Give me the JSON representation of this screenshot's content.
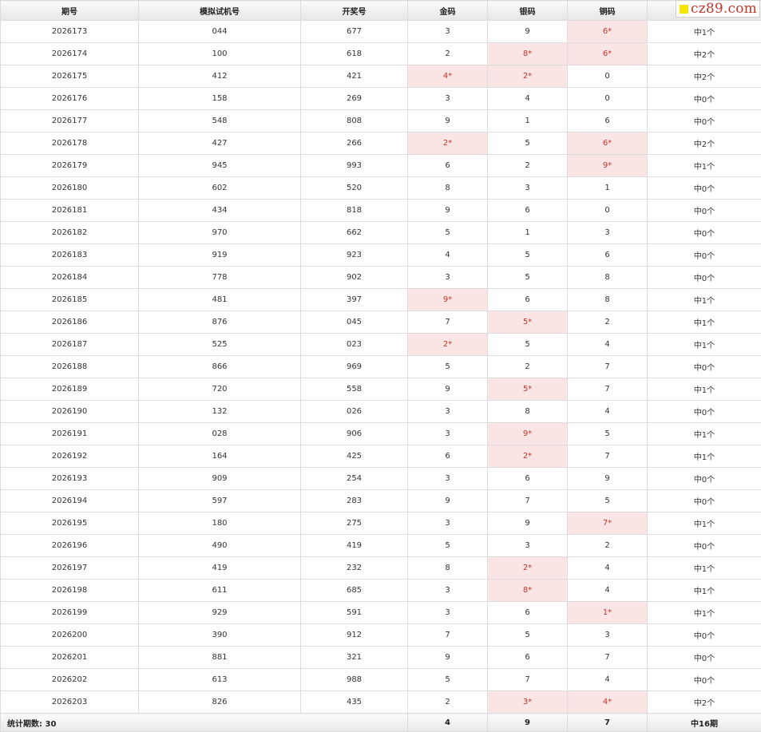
{
  "table": {
    "columns": [
      "期号",
      "模拟试机号",
      "开奖号",
      "金码",
      "银码",
      "铜码",
      ""
    ],
    "rows": [
      {
        "period": "2026173",
        "trial": "044",
        "draw": "677",
        "gold": "3",
        "silver": "9",
        "copper": "6*",
        "result": "中1个"
      },
      {
        "period": "2026174",
        "trial": "100",
        "draw": "618",
        "gold": "2",
        "silver": "8*",
        "copper": "6*",
        "result": "中2个"
      },
      {
        "period": "2026175",
        "trial": "412",
        "draw": "421",
        "gold": "4*",
        "silver": "2*",
        "copper": "0",
        "result": "中2个"
      },
      {
        "period": "2026176",
        "trial": "158",
        "draw": "269",
        "gold": "3",
        "silver": "4",
        "copper": "0",
        "result": "中0个"
      },
      {
        "period": "2026177",
        "trial": "548",
        "draw": "808",
        "gold": "9",
        "silver": "1",
        "copper": "6",
        "result": "中0个"
      },
      {
        "period": "2026178",
        "trial": "427",
        "draw": "266",
        "gold": "2*",
        "silver": "5",
        "copper": "6*",
        "result": "中2个"
      },
      {
        "period": "2026179",
        "trial": "945",
        "draw": "993",
        "gold": "6",
        "silver": "2",
        "copper": "9*",
        "result": "中1个"
      },
      {
        "period": "2026180",
        "trial": "602",
        "draw": "520",
        "gold": "8",
        "silver": "3",
        "copper": "1",
        "result": "中0个"
      },
      {
        "period": "2026181",
        "trial": "434",
        "draw": "818",
        "gold": "9",
        "silver": "6",
        "copper": "0",
        "result": "中0个"
      },
      {
        "period": "2026182",
        "trial": "970",
        "draw": "662",
        "gold": "5",
        "silver": "1",
        "copper": "3",
        "result": "中0个"
      },
      {
        "period": "2026183",
        "trial": "919",
        "draw": "923",
        "gold": "4",
        "silver": "5",
        "copper": "6",
        "result": "中0个"
      },
      {
        "period": "2026184",
        "trial": "778",
        "draw": "902",
        "gold": "3",
        "silver": "5",
        "copper": "8",
        "result": "中0个"
      },
      {
        "period": "2026185",
        "trial": "481",
        "draw": "397",
        "gold": "9*",
        "silver": "6",
        "copper": "8",
        "result": "中1个"
      },
      {
        "period": "2026186",
        "trial": "876",
        "draw": "045",
        "gold": "7",
        "silver": "5*",
        "copper": "2",
        "result": "中1个"
      },
      {
        "period": "2026187",
        "trial": "525",
        "draw": "023",
        "gold": "2*",
        "silver": "5",
        "copper": "4",
        "result": "中1个"
      },
      {
        "period": "2026188",
        "trial": "866",
        "draw": "969",
        "gold": "5",
        "silver": "2",
        "copper": "7",
        "result": "中0个"
      },
      {
        "period": "2026189",
        "trial": "720",
        "draw": "558",
        "gold": "9",
        "silver": "5*",
        "copper": "7",
        "result": "中1个"
      },
      {
        "period": "2026190",
        "trial": "132",
        "draw": "026",
        "gold": "3",
        "silver": "8",
        "copper": "4",
        "result": "中0个"
      },
      {
        "period": "2026191",
        "trial": "028",
        "draw": "906",
        "gold": "3",
        "silver": "9*",
        "copper": "5",
        "result": "中1个"
      },
      {
        "period": "2026192",
        "trial": "164",
        "draw": "425",
        "gold": "6",
        "silver": "2*",
        "copper": "7",
        "result": "中1个"
      },
      {
        "period": "2026193",
        "trial": "909",
        "draw": "254",
        "gold": "3",
        "silver": "6",
        "copper": "9",
        "result": "中0个"
      },
      {
        "period": "2026194",
        "trial": "597",
        "draw": "283",
        "gold": "9",
        "silver": "7",
        "copper": "5",
        "result": "中0个"
      },
      {
        "period": "2026195",
        "trial": "180",
        "draw": "275",
        "gold": "3",
        "silver": "9",
        "copper": "7*",
        "result": "中1个"
      },
      {
        "period": "2026196",
        "trial": "490",
        "draw": "419",
        "gold": "5",
        "silver": "3",
        "copper": "2",
        "result": "中0个"
      },
      {
        "period": "2026197",
        "trial": "419",
        "draw": "232",
        "gold": "8",
        "silver": "2*",
        "copper": "4",
        "result": "中1个"
      },
      {
        "period": "2026198",
        "trial": "611",
        "draw": "685",
        "gold": "3",
        "silver": "8*",
        "copper": "4",
        "result": "中1个"
      },
      {
        "period": "2026199",
        "trial": "929",
        "draw": "591",
        "gold": "3",
        "silver": "6",
        "copper": "1*",
        "result": "中1个"
      },
      {
        "period": "2026200",
        "trial": "390",
        "draw": "912",
        "gold": "7",
        "silver": "5",
        "copper": "3",
        "result": "中0个"
      },
      {
        "period": "2026201",
        "trial": "881",
        "draw": "321",
        "gold": "9",
        "silver": "6",
        "copper": "7",
        "result": "中0个"
      },
      {
        "period": "2026202",
        "trial": "613",
        "draw": "988",
        "gold": "5",
        "silver": "7",
        "copper": "4",
        "result": "中0个"
      },
      {
        "period": "2026203",
        "trial": "826",
        "draw": "435",
        "gold": "2",
        "silver": "3*",
        "copper": "4*",
        "result": "中2个"
      }
    ],
    "footer": {
      "label": "统计期数: 30",
      "gold_hits": "4",
      "silver_hits": "9",
      "copper_hits": "7",
      "total": "中16期"
    }
  },
  "watermark": {
    "text": "cz89.com"
  },
  "colors": {
    "hit_background": "#fae4e4",
    "hit_text": "#c0392b",
    "watermark_square": "#f5e500",
    "watermark_text": "#c0392b"
  }
}
